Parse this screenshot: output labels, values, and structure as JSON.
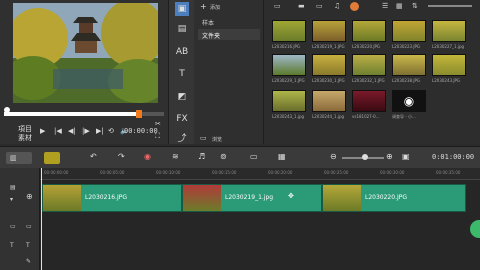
{
  "preview": {
    "mode_project": "項目",
    "mode_clip": "素材",
    "timecode": "00:00:00",
    "progress": 0.85
  },
  "tools": [
    "media-icon",
    "instant-project-icon",
    "transition-icon",
    "title-icon",
    "graphic-icon",
    "filter-icon",
    "path-icon"
  ],
  "folders": {
    "add_label": "添加",
    "items": [
      "样本",
      "文件夹"
    ],
    "browse_label": "浏览"
  },
  "library": {
    "items": [
      "L2030216.JPG",
      "L2030219_1.JPG",
      "L2030220.JPG",
      "L2030223.JPG",
      "L2030227_1.jpg",
      "L2030229_1.JPG",
      "L2030230_1.JPG",
      "L2030232_1.JPG",
      "L2030238.JPG",
      "L2030243.JPG",
      "L2030243_1.jpg",
      "L2030244_1.jpg",
      "vs181027-0...",
      "调查导 - 小..."
    ]
  },
  "timeline": {
    "timecode": "0:01:00:00",
    "ruler": [
      "00:00:00:00",
      "00:00:05:00",
      "00:00:10:00",
      "00:00:15:00",
      "00:00:20:00",
      "00:00:25:00",
      "00:00:30:00",
      "00:00:35:00"
    ],
    "clips": [
      "L2030216.JPG",
      "L2030219_1.jpg",
      "L2030220.JPG"
    ]
  }
}
